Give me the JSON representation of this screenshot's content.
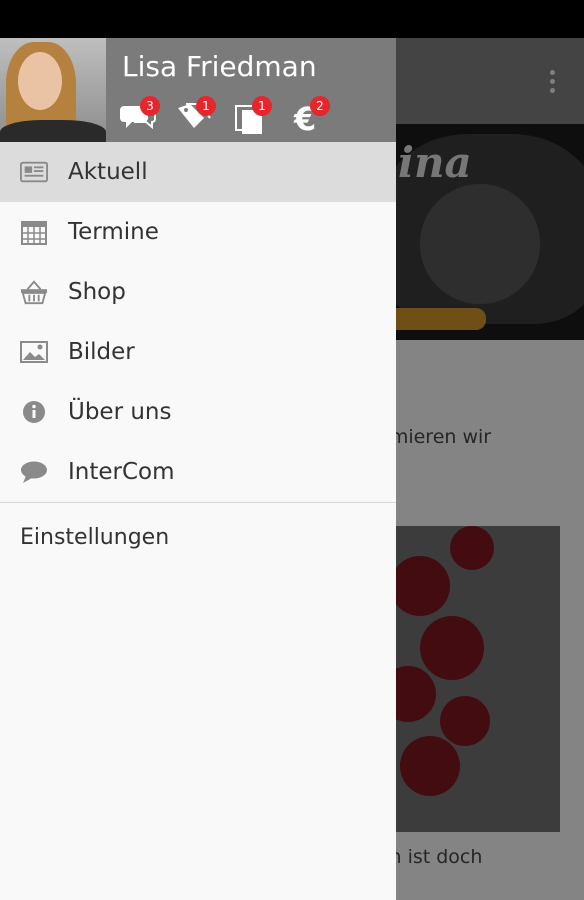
{
  "user": {
    "name": "Lisa Friedman"
  },
  "header_icons": [
    {
      "name": "chat-icon",
      "badge": "3"
    },
    {
      "name": "tags-icon",
      "badge": "1"
    },
    {
      "name": "documents-icon",
      "badge": "1"
    },
    {
      "name": "euro-icon",
      "badge": "2"
    }
  ],
  "menu": {
    "items": [
      {
        "label": "Aktuell",
        "icon": "newspaper-icon"
      },
      {
        "label": "Termine",
        "icon": "calendar-icon"
      },
      {
        "label": "Shop",
        "icon": "basket-icon"
      },
      {
        "label": "Bilder",
        "icon": "image-icon"
      },
      {
        "label": "Über uns",
        "icon": "info-icon"
      },
      {
        "label": "InterCom",
        "icon": "speech-bubble-icon"
      }
    ],
    "settings_label": "Einstellungen"
  },
  "background": {
    "hero_text": "ina",
    "text1": "nformieren wir",
    "text2": "zilien ist doch",
    "text3": "och"
  },
  "colors": {
    "badge": "#e5262c",
    "header": "#7b7b7b",
    "active": "#dcdcdc"
  }
}
